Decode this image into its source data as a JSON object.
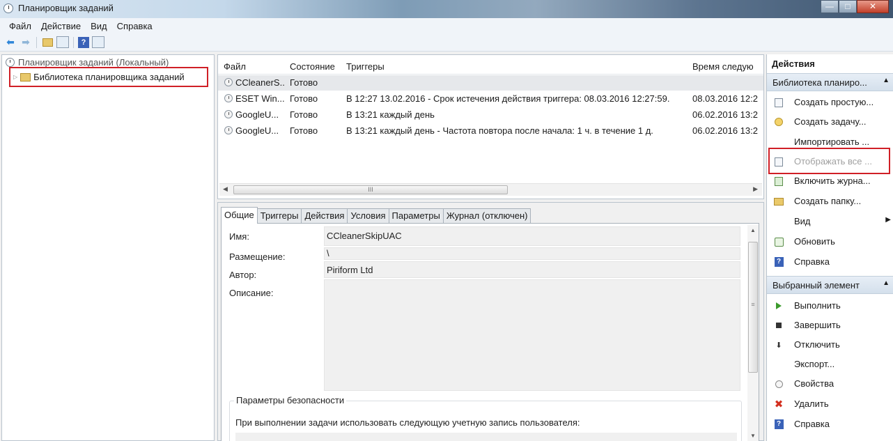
{
  "window": {
    "title": "Планировщик заданий",
    "controls": {
      "minimize": "—",
      "maximize": "□",
      "close": "✕"
    }
  },
  "menu": [
    "Файл",
    "Действие",
    "Вид",
    "Справка"
  ],
  "tree": {
    "root": "Планировщик заданий (Локальный)",
    "child": "Библиотека планировщика заданий"
  },
  "task_list": {
    "columns": [
      "Файл",
      "Состояние",
      "Триггеры",
      "Время следую"
    ],
    "rows": [
      {
        "name": "CCleanerS...",
        "status": "Готово",
        "trigger": "",
        "next": ""
      },
      {
        "name": "ESET Win...",
        "status": "Готово",
        "trigger": "В 12:27 13.02.2016 - Срок истечения действия триггера: 08.03.2016 12:27:59.",
        "next": "08.03.2016 12:2"
      },
      {
        "name": "GoogleU...",
        "status": "Готово",
        "trigger": "В 13:21 каждый день",
        "next": "06.02.2016 13:2"
      },
      {
        "name": "GoogleU...",
        "status": "Готово",
        "trigger": "В 13:21 каждый день - Частота повтора после начала: 1 ч. в течение 1 д.",
        "next": "06.02.2016 13:2"
      }
    ],
    "scroll_grip": "III"
  },
  "details": {
    "tabs": [
      "Общие",
      "Триггеры",
      "Действия",
      "Условия",
      "Параметры",
      "Журнал (отключен)"
    ],
    "fields": {
      "name_label": "Имя:",
      "name_value": "CCleanerSkipUAC",
      "location_label": "Размещение:",
      "location_value": "\\",
      "author_label": "Автор:",
      "author_value": "Piriform Ltd",
      "description_label": "Описание:",
      "description_value": ""
    },
    "security": {
      "title": "Параметры безопасности",
      "text": "При выполнении задачи использовать следующую учетную запись пользователя:"
    }
  },
  "actions": {
    "title": "Действия",
    "section1": {
      "header": "Библиотека планиро...",
      "items": [
        "Создать простую...",
        "Создать задачу...",
        "Импортировать ...",
        "Отображать все ...",
        "Включить журна...",
        "Создать папку...",
        "Вид",
        "Обновить",
        "Справка"
      ]
    },
    "section2": {
      "header": "Выбранный элемент",
      "items": [
        "Выполнить",
        "Завершить",
        "Отключить",
        "Экспорт...",
        "Свойства",
        "Удалить",
        "Справка"
      ]
    }
  }
}
